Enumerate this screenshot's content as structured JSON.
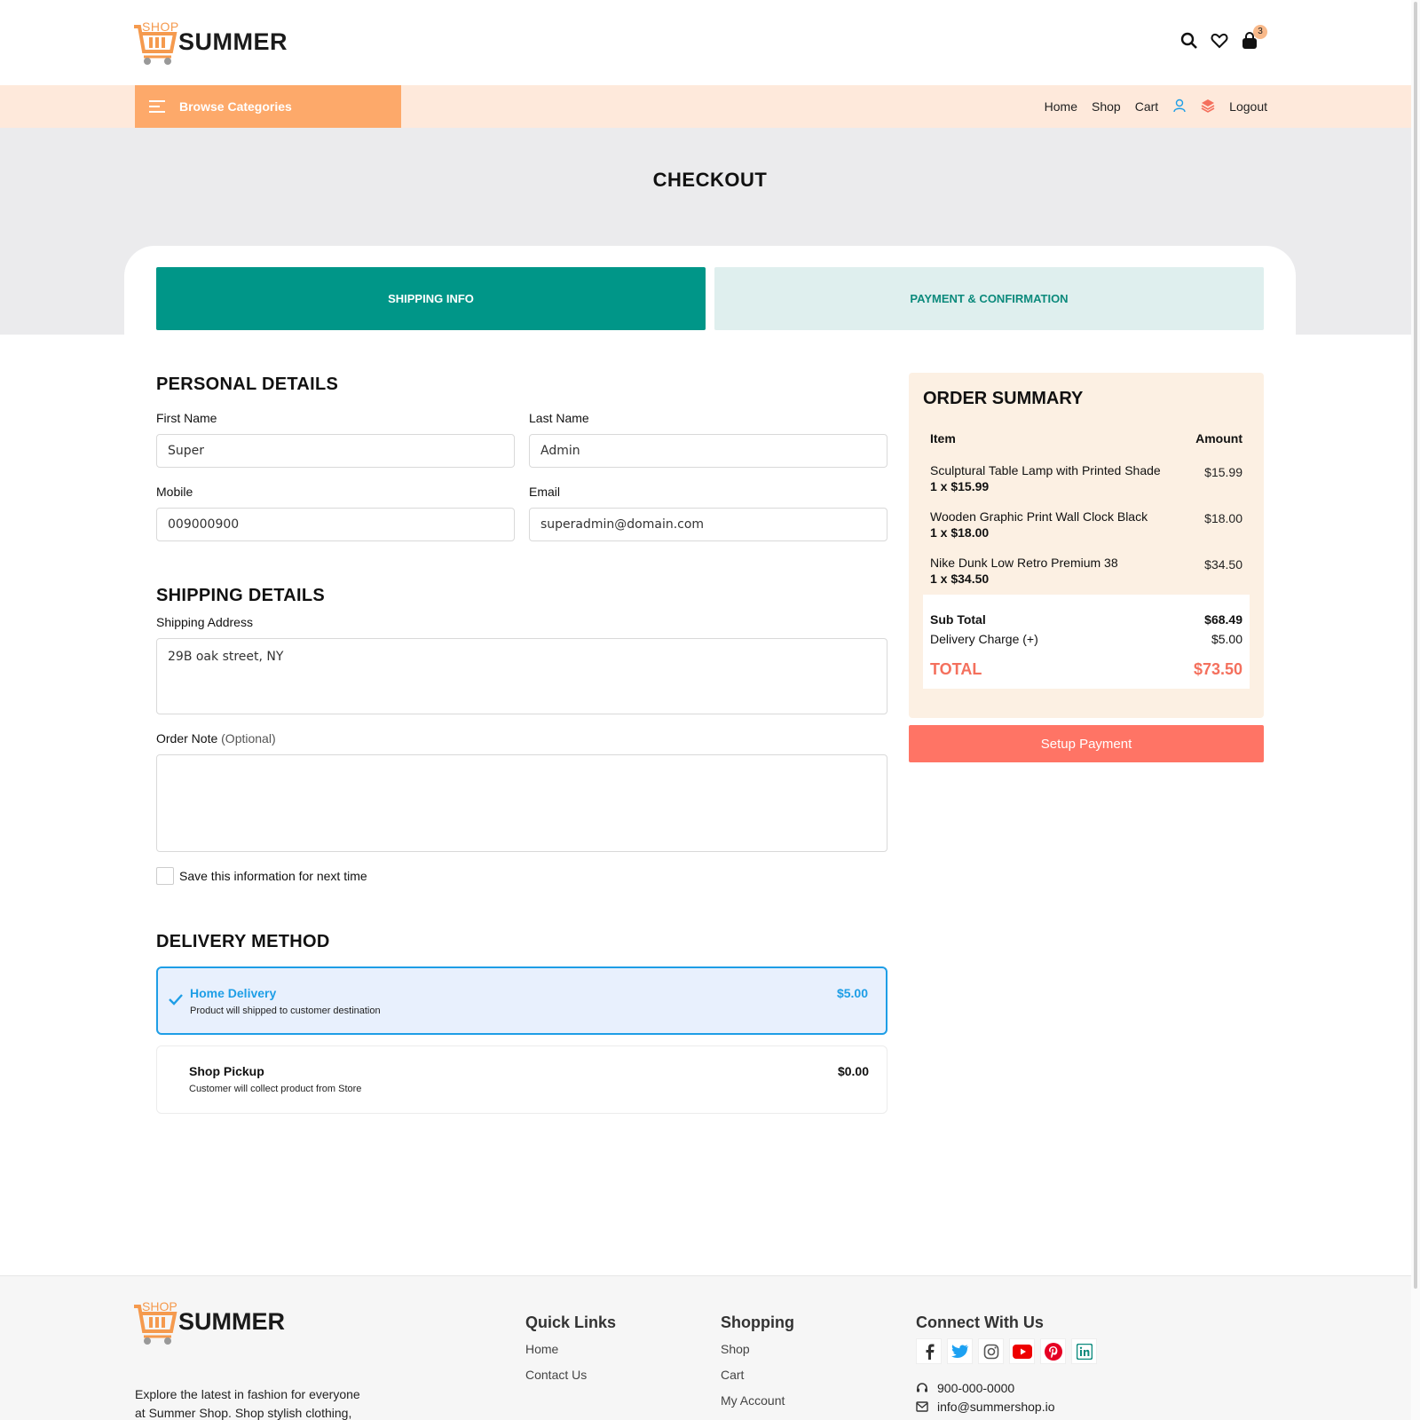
{
  "header": {
    "logo_small": "SHOP",
    "logo_big": "SUMMER",
    "cart_count": "3"
  },
  "nav": {
    "browse_label": "Browse Categories",
    "links": [
      "Home",
      "Shop",
      "Cart"
    ],
    "logout": "Logout"
  },
  "page": {
    "title": "CHECKOUT",
    "tabs": [
      "SHIPPING INFO",
      "PAYMENT & CONFIRMATION"
    ]
  },
  "personal": {
    "heading": "PERSONAL DETAILS",
    "first_name_label": "First Name",
    "first_name": "Super",
    "last_name_label": "Last Name",
    "last_name": "Admin",
    "mobile_label": "Mobile",
    "mobile": "009000900",
    "email_label": "Email",
    "email": "superadmin@domain.com"
  },
  "shipping": {
    "heading": "SHIPPING DETAILS",
    "address_label": "Shipping Address",
    "address": "29B oak street, NY",
    "note_label": "Order Note",
    "note_optional": "(Optional)",
    "note": "",
    "save_label": "Save this information for next time"
  },
  "delivery": {
    "heading": "DELIVERY METHOD",
    "options": [
      {
        "title": "Home Delivery",
        "desc": "Product will shipped to customer destination",
        "price": "$5.00",
        "selected": true
      },
      {
        "title": "Shop Pickup",
        "desc": "Customer will collect product from Store",
        "price": "$0.00",
        "selected": false
      }
    ]
  },
  "summary": {
    "heading": "ORDER SUMMARY",
    "col_item": "Item",
    "col_amount": "Amount",
    "items": [
      {
        "name": "Sculptural Table Lamp with Printed Shade",
        "qty": "1 x $15.99",
        "amount": "$15.99"
      },
      {
        "name": "Wooden Graphic Print Wall Clock Black",
        "qty": "1 x $18.00",
        "amount": "$18.00"
      },
      {
        "name": "Nike Dunk Low Retro Premium 38",
        "qty": "1 x $34.50",
        "amount": "$34.50"
      }
    ],
    "subtotal_label": "Sub Total",
    "subtotal": "$68.49",
    "delivery_label": "Delivery Charge (+)",
    "delivery": "$5.00",
    "total_label": "TOTAL",
    "total": "$73.50",
    "pay_button": "Setup Payment"
  },
  "footer": {
    "about": "Explore the latest in fashion for everyone at Summer Shop. Shop stylish clothing,",
    "quick_links_heading": "Quick Links",
    "quick_links": [
      "Home",
      "Contact Us"
    ],
    "shopping_heading": "Shopping",
    "shopping_links": [
      "Shop",
      "Cart",
      "My Account"
    ],
    "connect_heading": "Connect With Us",
    "social": [
      "facebook-icon",
      "twitter-icon",
      "instagram-icon",
      "youtube-icon",
      "pinterest-icon",
      "linkedin-icon"
    ],
    "phone": "900-000-0000",
    "email": "info@summershop.io"
  },
  "colors": {
    "accent_teal": "#009688",
    "accent_orange": "#fda96a",
    "accent_coral": "#ff7465",
    "selected_blue": "#1e9ee6"
  }
}
